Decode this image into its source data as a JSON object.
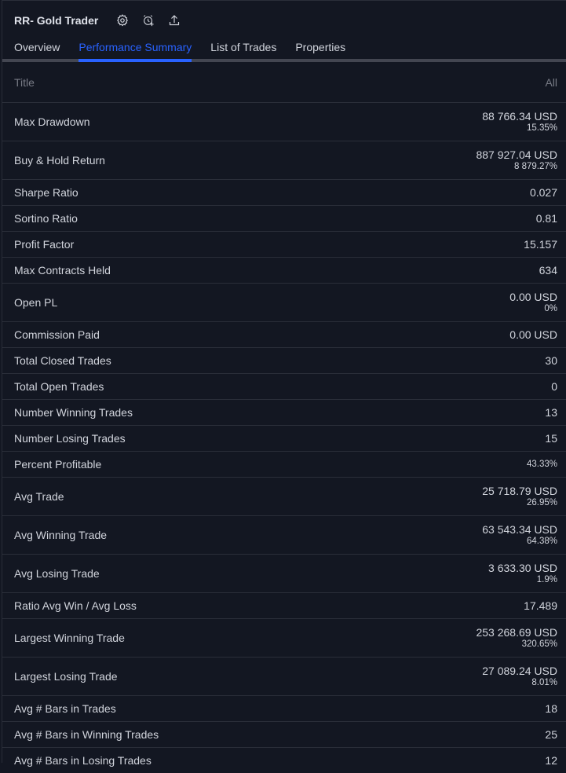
{
  "header": {
    "title": "RR- Gold Trader"
  },
  "tabs": [
    "Overview",
    "Performance Summary",
    "List of Trades",
    "Properties"
  ],
  "table": {
    "title_col": "Title",
    "value_col": "All",
    "rows": [
      {
        "label": "Max Drawdown",
        "main": "88 766.34 USD",
        "sub": "15.35%"
      },
      {
        "label": "Buy & Hold Return",
        "main": "887 927.04 USD",
        "sub": "8 879.27%"
      },
      {
        "label": "Sharpe Ratio",
        "main": "0.027"
      },
      {
        "label": "Sortino Ratio",
        "main": "0.81"
      },
      {
        "label": "Profit Factor",
        "main": "15.157"
      },
      {
        "label": "Max Contracts Held",
        "main": "634"
      },
      {
        "label": "Open PL",
        "main": "0.00 USD",
        "sub": "0%"
      },
      {
        "label": "Commission Paid",
        "main": "0.00 USD"
      },
      {
        "label": "Total Closed Trades",
        "main": "30"
      },
      {
        "label": "Total Open Trades",
        "main": "0"
      },
      {
        "label": "Number Winning Trades",
        "main": "13"
      },
      {
        "label": "Number Losing Trades",
        "main": "15"
      },
      {
        "label": "Percent Profitable",
        "sub": "43.33%"
      },
      {
        "label": "Avg Trade",
        "main": "25 718.79 USD",
        "sub": "26.95%"
      },
      {
        "label": "Avg Winning Trade",
        "main": "63 543.34 USD",
        "sub": "64.38%"
      },
      {
        "label": "Avg Losing Trade",
        "main": "3 633.30 USD",
        "sub": "1.9%"
      },
      {
        "label": "Ratio Avg Win / Avg Loss",
        "main": "17.489"
      },
      {
        "label": "Largest Winning Trade",
        "main": "253 268.69 USD",
        "sub": "320.65%"
      },
      {
        "label": "Largest Losing Trade",
        "main": "27 089.24 USD",
        "sub": "8.01%"
      },
      {
        "label": "Avg # Bars in Trades",
        "main": "18"
      },
      {
        "label": "Avg # Bars in Winning Trades",
        "main": "25"
      },
      {
        "label": "Avg # Bars in Losing Trades",
        "main": "12"
      }
    ]
  }
}
